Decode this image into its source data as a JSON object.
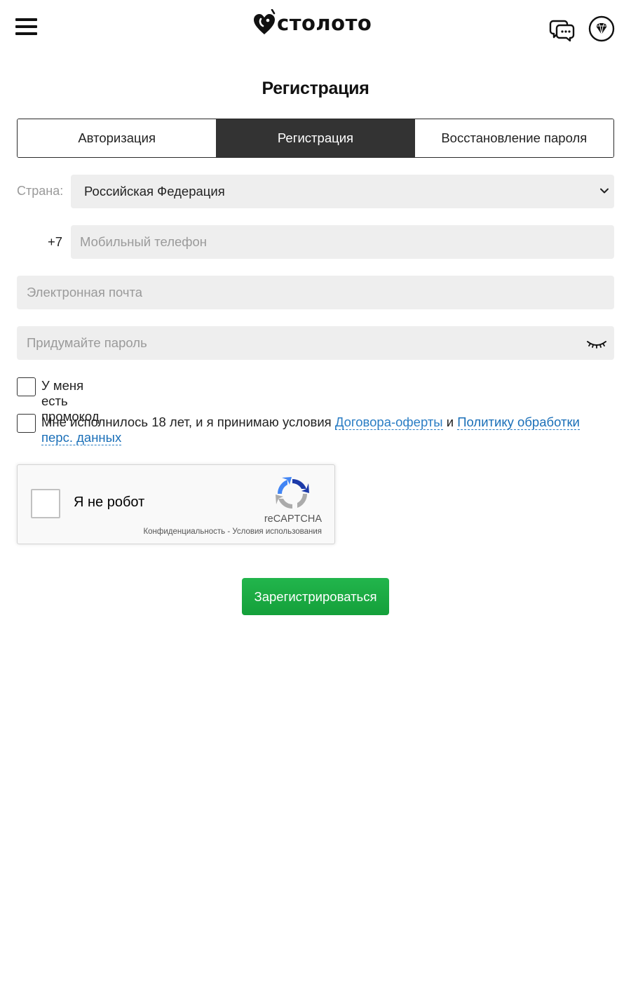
{
  "header": {
    "logo_text": "столото",
    "menu_icon": "hamburger-menu-icon",
    "chat_icon": "chat-bubbles-icon",
    "gem_icon": "diamond-icon"
  },
  "page": {
    "title": "Регистрация"
  },
  "tabs": [
    {
      "label": "Авторизация",
      "active": false
    },
    {
      "label": "Регистрация",
      "active": true
    },
    {
      "label": "Восстановление пароля",
      "active": false
    }
  ],
  "form": {
    "country_label": "Страна:",
    "country_value": "Российская Федерация",
    "phone_prefix": "+7",
    "phone_placeholder": "Мобильный телефон",
    "email_placeholder": "Электронная почта",
    "password_placeholder": "Придумайте пароль",
    "promo_label": "У меня есть промокод",
    "agree_text_1": "Мне исполнилось 18 лет, и я принимаю условия",
    "agree_link_1": "Договора-оферты",
    "agree_and": "и",
    "agree_link_2": "Политику обработки перс. данных"
  },
  "recaptcha": {
    "label": "Я не робот",
    "brand": "reCAPTCHA",
    "privacy": "Конфиденциальность",
    "separator": "-",
    "terms": "Условия использования"
  },
  "submit_label": "Зарегистрироваться",
  "colors": {
    "active_tab": "#333333",
    "field_bg": "#eeeeee",
    "submit_green": "#1aaa44",
    "link_blue": "#2a7dc4"
  }
}
